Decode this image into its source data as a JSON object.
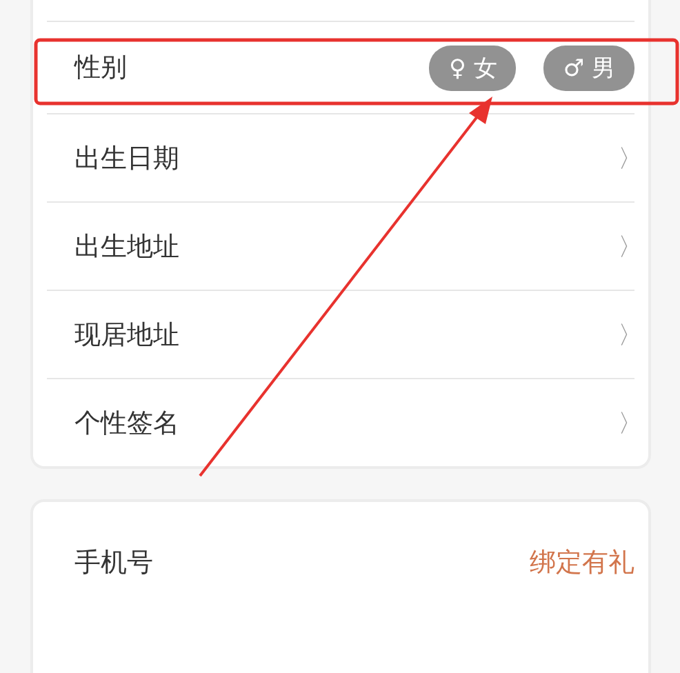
{
  "profile_card": {
    "gender": {
      "label": "性别",
      "options": [
        {
          "symbol": "♀",
          "label": "女",
          "selected": false
        },
        {
          "symbol": "♂",
          "label": "男",
          "selected": false
        }
      ]
    },
    "rows": [
      {
        "label": "出生日期",
        "chevron": "〉"
      },
      {
        "label": "出生地址",
        "chevron": "〉"
      },
      {
        "label": "现居地址",
        "chevron": "〉"
      },
      {
        "label": "个性签名",
        "chevron": "〉"
      }
    ]
  },
  "account_card": {
    "rows": [
      {
        "label": "手机号",
        "action": "绑定有礼"
      }
    ]
  }
}
